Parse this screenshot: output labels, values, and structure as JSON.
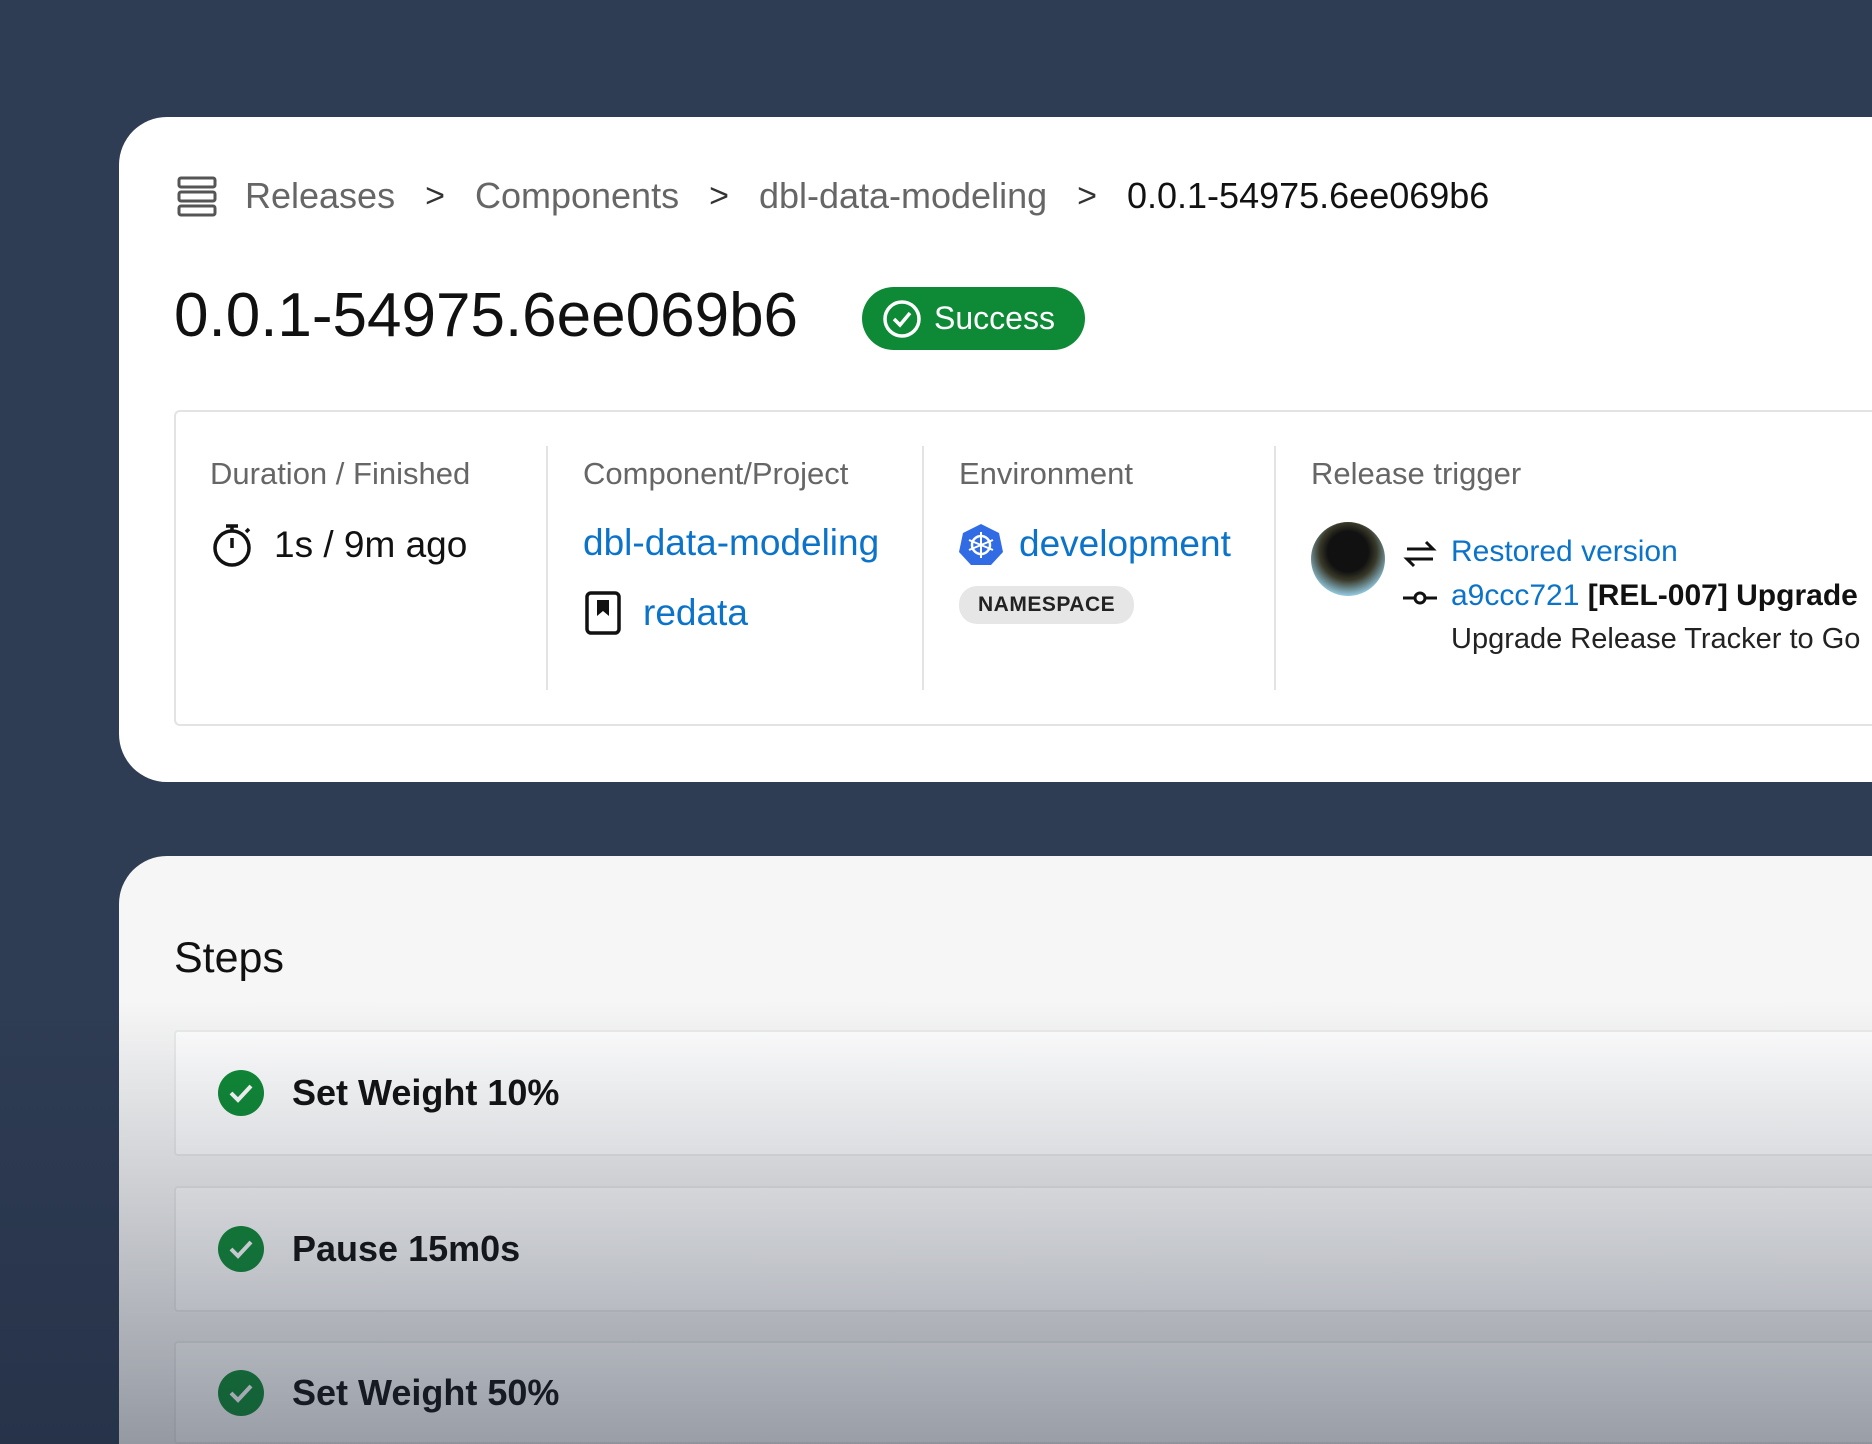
{
  "breadcrumb": {
    "items": [
      "Releases",
      "Components",
      "dbl-data-modeling"
    ],
    "current": "0.0.1-54975.6ee069b6"
  },
  "release": {
    "title": "0.0.1-54975.6ee069b6",
    "status": "Success",
    "status_color": "#0e8a36"
  },
  "info": {
    "duration": {
      "label": "Duration / Finished",
      "value": "1s / 9m ago"
    },
    "component": {
      "label": "Component/Project",
      "component": "dbl-data-modeling",
      "project": "redata"
    },
    "environment": {
      "label": "Environment",
      "name": "development",
      "badge": "NAMESPACE"
    },
    "trigger": {
      "label": "Release trigger",
      "action": "Restored version",
      "commit_sha": "a9ccc721",
      "commit_title": "[REL-007] Upgrade",
      "commit_message": "Upgrade Release Tracker to Go"
    }
  },
  "steps": {
    "title": "Steps",
    "items": [
      {
        "label": "Set Weight 10%",
        "status": "success"
      },
      {
        "label": "Pause 15m0s",
        "status": "success"
      },
      {
        "label": "Set Weight 50%",
        "status": "success"
      }
    ]
  },
  "colors": {
    "link": "#0b73c9",
    "background": "#2e3c54"
  }
}
